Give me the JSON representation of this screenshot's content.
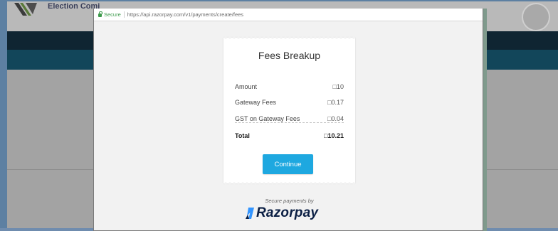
{
  "background": {
    "site_title": "Election Comi"
  },
  "browser": {
    "secure_label": "Secure",
    "url": "https://api.razorpay.com/v1/payments/create/fees"
  },
  "fees": {
    "title": "Fees Breakup",
    "rows": [
      {
        "label": "Amount",
        "value": "□10"
      },
      {
        "label": "Gateway Fees",
        "value": "□0.17"
      },
      {
        "label": "GST on Gateway Fees",
        "value": "□0.04"
      }
    ],
    "total": {
      "label": "Total",
      "value": "□10.21"
    },
    "continue_label": "Continue"
  },
  "footer": {
    "secure_payments": "Secure payments by",
    "brand": "Razorpay"
  },
  "colors": {
    "button": "#1ea8e0",
    "brand_text": "#0b1f44",
    "brand_logo": "#3395ff",
    "secure_green": "#3c9a4b"
  },
  "icons": {
    "lock": "lock-icon",
    "brand_logo": "razorpay-logo-icon",
    "site_logo": "site-logo-icon"
  }
}
